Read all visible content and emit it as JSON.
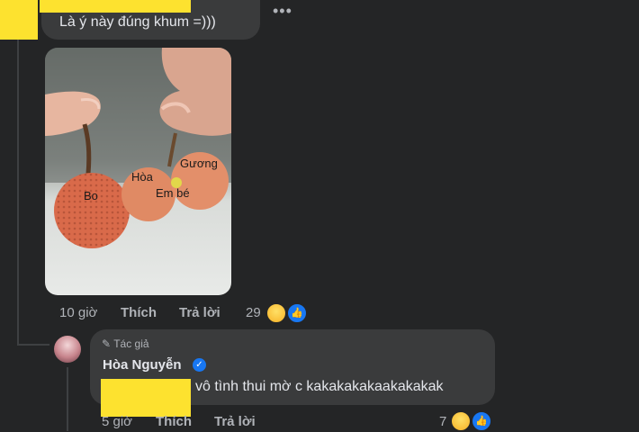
{
  "comment": {
    "text": "Là ý này đúng khum =)))",
    "more_label": "•••",
    "photo_labels": [
      "Bo",
      "Hòa",
      "Gương",
      "Em bé"
    ],
    "time": "10 giờ",
    "like_label": "Thích",
    "reply_label": "Trả lời",
    "reaction_count": "29"
  },
  "reply": {
    "badge": "Tác giả",
    "author": "Hòa Nguyễn",
    "text": "vô tình thui mờ c kakakakakaakakakak",
    "time": "5 giờ",
    "like_label": "Thích",
    "reply_label": "Trả lời",
    "reaction_count": "7"
  },
  "colors": {
    "background": "#242526",
    "bubble": "#3a3b3c",
    "redaction": "#fde22f",
    "like_blue": "#1877f2"
  },
  "icons": [
    "more-icon",
    "haha-reaction-icon",
    "like-reaction-icon",
    "pen-icon",
    "verified-badge-icon"
  ]
}
